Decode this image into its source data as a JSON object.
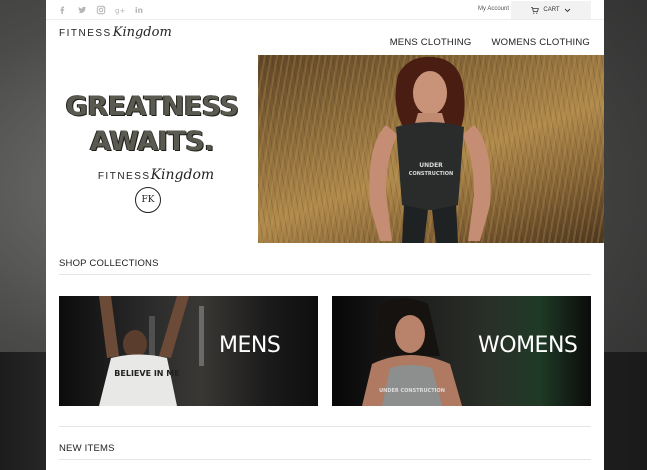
{
  "topbar": {
    "social_icons": [
      "facebook-icon",
      "twitter-icon",
      "instagram-icon",
      "google-plus-icon",
      "linkedin-icon"
    ],
    "account_label": "My Account",
    "cart_label": "CART"
  },
  "header": {
    "logo_text_1": "FITNESS",
    "logo_text_2": "Kingdom",
    "nav": [
      "MENS CLOTHING",
      "WOMENS CLOTHING"
    ]
  },
  "hero": {
    "headline_line1": "GREATNESS",
    "headline_line2": "AWAITS.",
    "logo_text_1": "FITNESS",
    "logo_text_2": "Kingdom",
    "badge": "FK",
    "shirt_text_1": "UNDER",
    "shirt_text_2": "CONSTRUCTION"
  },
  "collections": {
    "title": "SHOP COLLECTIONS",
    "items": [
      {
        "label": "MENS",
        "shirt_text": "BELIEVE IN ME"
      },
      {
        "label": "WOMENS",
        "shirt_text": "UNDER CONSTRUCTION"
      }
    ]
  },
  "new_items": {
    "title": "NEW ITEMS"
  },
  "colors": {
    "headline": "#5a5a50",
    "background_dark": "#2a2a2a",
    "text": "#222222",
    "cart_bg": "#f2f2f2"
  }
}
